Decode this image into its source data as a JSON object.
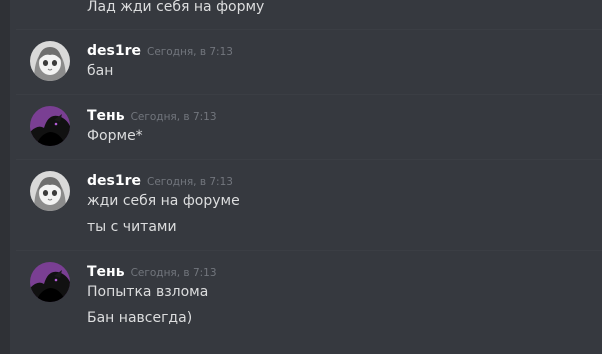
{
  "colors": {
    "background": "#36393f",
    "username": "#ffffff",
    "timestamp": "#72767d",
    "message_text": "#dcddde"
  },
  "messages": [
    {
      "continuation": true,
      "lines": [
        "Лад жди себя на форму"
      ]
    },
    {
      "author": "des1re",
      "avatar_icon": "anime-girl-avatar-icon",
      "timestamp": "Сегодня, в 7:13",
      "lines": [
        "бан"
      ]
    },
    {
      "author": "Тень",
      "avatar_icon": "shadow-figure-avatar-icon",
      "timestamp": "Сегодня, в 7:13",
      "lines": [
        "Форме*"
      ]
    },
    {
      "author": "des1re",
      "avatar_icon": "anime-girl-avatar-icon",
      "timestamp": "Сегодня, в 7:13",
      "lines": [
        "жди себя на форуме",
        "ты с читами"
      ]
    },
    {
      "author": "Тень",
      "avatar_icon": "shadow-figure-avatar-icon",
      "timestamp": "Сегодня, в 7:13",
      "lines": [
        "Попытка взлома",
        "Бан навсегда)"
      ]
    }
  ]
}
